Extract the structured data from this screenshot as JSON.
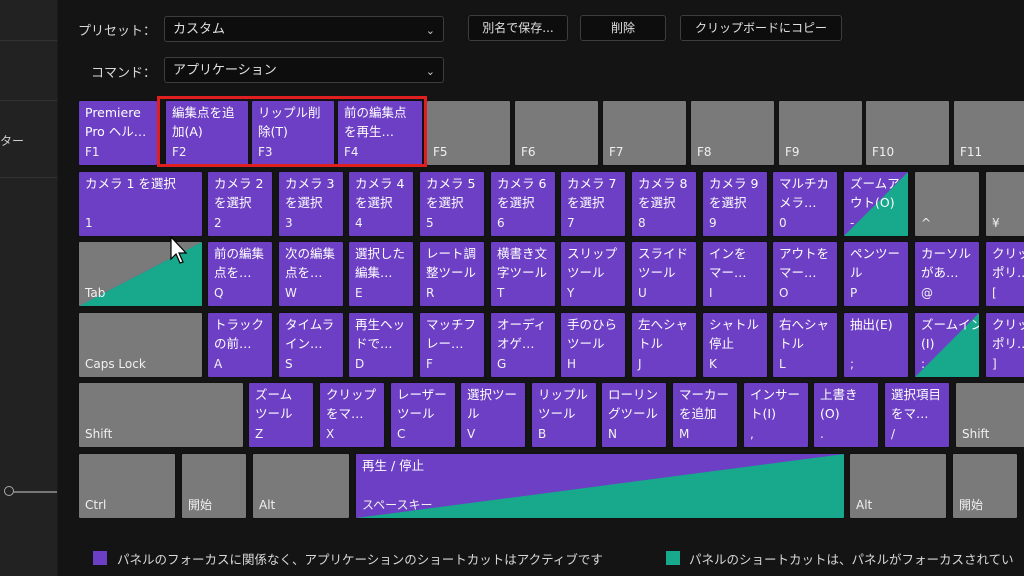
{
  "sidebar": {
    "label": "ター"
  },
  "preset": {
    "label": "プリセット：",
    "value": "カスタム"
  },
  "buttons": {
    "save_as": "別名で保存...",
    "delete": "削除",
    "copy": "クリップボードにコピー"
  },
  "command": {
    "label": "コマンド：",
    "value": "アプリケーション"
  },
  "colors": {
    "purple": "#6c3fc4",
    "green": "#18a88c",
    "gray": "#7a7a7a",
    "highlight": "#e02020"
  },
  "keys": [
    {
      "id": "f1",
      "label": "Premiere\nPro ヘル…",
      "name": "F1",
      "color": "purple"
    },
    {
      "id": "f2",
      "label": "編集点を追\n加(A)",
      "name": "F2",
      "color": "purple"
    },
    {
      "id": "f3",
      "label": "リップル削\n除(T)",
      "name": "F3",
      "color": "purple"
    },
    {
      "id": "f4",
      "label": "前の編集点\nを再生…",
      "name": "F4",
      "color": "purple"
    },
    {
      "id": "f5",
      "label": "",
      "name": "F5",
      "color": "gray"
    },
    {
      "id": "f6",
      "label": "",
      "name": "F6",
      "color": "gray"
    },
    {
      "id": "f7",
      "label": "",
      "name": "F7",
      "color": "gray"
    },
    {
      "id": "f8",
      "label": "",
      "name": "F8",
      "color": "gray"
    },
    {
      "id": "f9",
      "label": "",
      "name": "F9",
      "color": "gray"
    },
    {
      "id": "f10",
      "label": "",
      "name": "F10",
      "color": "gray"
    },
    {
      "id": "f11",
      "label": "",
      "name": "F11",
      "color": "gray"
    },
    {
      "id": "k1",
      "label": "カメラ 1 を選択",
      "name": "1",
      "color": "purple"
    },
    {
      "id": "k2",
      "label": "カメラ 2\nを選択",
      "name": "2",
      "color": "purple"
    },
    {
      "id": "k3",
      "label": "カメラ 3\nを選択",
      "name": "3",
      "color": "purple"
    },
    {
      "id": "k4",
      "label": "カメラ 4\nを選択",
      "name": "4",
      "color": "purple"
    },
    {
      "id": "k5",
      "label": "カメラ 5\nを選択",
      "name": "5",
      "color": "purple"
    },
    {
      "id": "k6",
      "label": "カメラ 6\nを選択",
      "name": "6",
      "color": "purple"
    },
    {
      "id": "k7",
      "label": "カメラ 7\nを選択",
      "name": "7",
      "color": "purple"
    },
    {
      "id": "k8",
      "label": "カメラ 8\nを選択",
      "name": "8",
      "color": "purple"
    },
    {
      "id": "k9",
      "label": "カメラ 9\nを選択",
      "name": "9",
      "color": "purple"
    },
    {
      "id": "k0",
      "label": "マルチカ\nメラ…",
      "name": "0",
      "color": "purple"
    },
    {
      "id": "kminus",
      "label": "ズームア\nウト(O)",
      "name": "-",
      "color": "split"
    },
    {
      "id": "kcaret",
      "label": "",
      "name": "^",
      "color": "gray"
    },
    {
      "id": "kyen",
      "label": "",
      "name": "¥",
      "color": "gray"
    },
    {
      "id": "tab",
      "label": "",
      "name": "Tab",
      "color": "split"
    },
    {
      "id": "kq",
      "label": "前の編集\n点を…",
      "name": "Q",
      "color": "purple"
    },
    {
      "id": "kw",
      "label": "次の編集\n点を…",
      "name": "W",
      "color": "purple"
    },
    {
      "id": "ke",
      "label": "選択した\n編集…",
      "name": "E",
      "color": "purple"
    },
    {
      "id": "kr",
      "label": "レート調\n整ツール",
      "name": "R",
      "color": "purple"
    },
    {
      "id": "kt",
      "label": "横書き文\n字ツール",
      "name": "T",
      "color": "purple"
    },
    {
      "id": "ky",
      "label": "スリップ\nツール",
      "name": "Y",
      "color": "purple"
    },
    {
      "id": "ku",
      "label": "スライド\nツール",
      "name": "U",
      "color": "purple"
    },
    {
      "id": "ki",
      "label": "インを\nマー…",
      "name": "I",
      "color": "purple"
    },
    {
      "id": "ko",
      "label": "アウトを\nマー…",
      "name": "O",
      "color": "purple"
    },
    {
      "id": "kp",
      "label": "ペンツー\nル",
      "name": "P",
      "color": "purple"
    },
    {
      "id": "kat",
      "label": "カーソル\nがあ…",
      "name": "@",
      "color": "purple"
    },
    {
      "id": "kbrl",
      "label": "クリッ\nポリ…",
      "name": "[",
      "color": "purple"
    },
    {
      "id": "caps",
      "label": "",
      "name": "Caps Lock",
      "color": "gray"
    },
    {
      "id": "ka",
      "label": "トラック\nの前…",
      "name": "A",
      "color": "purple"
    },
    {
      "id": "ks",
      "label": "タイムラ\nイン…",
      "name": "S",
      "color": "purple"
    },
    {
      "id": "kd",
      "label": "再生ヘッ\nドで…",
      "name": "D",
      "color": "purple"
    },
    {
      "id": "kf",
      "label": "マッチフ\nレー…",
      "name": "F",
      "color": "purple"
    },
    {
      "id": "kg",
      "label": "オーディ\nオゲ…",
      "name": "G",
      "color": "purple"
    },
    {
      "id": "kh",
      "label": "手のひら\nツール",
      "name": "H",
      "color": "purple"
    },
    {
      "id": "kj",
      "label": "左へシャ\nトル",
      "name": "J",
      "color": "purple"
    },
    {
      "id": "kk",
      "label": "シャトル\n停止",
      "name": "K",
      "color": "purple"
    },
    {
      "id": "kl",
      "label": "右へシャ\nトル",
      "name": "L",
      "color": "purple"
    },
    {
      "id": "ksemi",
      "label": "抽出(E)",
      "name": ";",
      "color": "purple"
    },
    {
      "id": "kcolon",
      "label": "ズームイン\n(I)",
      "name": ":",
      "color": "split"
    },
    {
      "id": "kbrr",
      "label": "クリッ\nポリ…",
      "name": "]",
      "color": "purple"
    },
    {
      "id": "lshift",
      "label": "",
      "name": "Shift",
      "color": "gray"
    },
    {
      "id": "kz",
      "label": "ズーム\nツール",
      "name": "Z",
      "color": "purple"
    },
    {
      "id": "kx",
      "label": "クリップ\nをマ…",
      "name": "X",
      "color": "purple"
    },
    {
      "id": "kc",
      "label": "レーザー\nツール",
      "name": "C",
      "color": "purple"
    },
    {
      "id": "kv",
      "label": "選択ツー\nル",
      "name": "V",
      "color": "purple"
    },
    {
      "id": "kb",
      "label": "リップル\nツール",
      "name": "B",
      "color": "purple"
    },
    {
      "id": "kn",
      "label": "ローリン\nグツール",
      "name": "N",
      "color": "purple"
    },
    {
      "id": "km",
      "label": "マーカー\nを追加",
      "name": "M",
      "color": "purple"
    },
    {
      "id": "kcomma",
      "label": "インサー\nト(I)",
      "name": ",",
      "color": "purple"
    },
    {
      "id": "kperiod",
      "label": "上書き\n(O)",
      "name": ".",
      "color": "purple"
    },
    {
      "id": "kslash",
      "label": "選択項目\nをマ…",
      "name": "/",
      "color": "purple"
    },
    {
      "id": "rshift",
      "label": "",
      "name": "Shift",
      "color": "gray"
    },
    {
      "id": "lctrl",
      "label": "",
      "name": "Ctrl",
      "color": "gray"
    },
    {
      "id": "lstart",
      "label": "",
      "name": "開始",
      "color": "gray"
    },
    {
      "id": "lalt",
      "label": "",
      "name": "Alt",
      "color": "gray"
    },
    {
      "id": "space",
      "label": "再生 / 停止",
      "name": "スペースキー",
      "color": "split"
    },
    {
      "id": "ralt",
      "label": "",
      "name": "Alt",
      "color": "gray"
    },
    {
      "id": "rstart",
      "label": "",
      "name": "開始",
      "color": "gray"
    }
  ],
  "legend": {
    "app": "パネルのフォーカスに関係なく、アプリケーションのショートカットはアクティブです",
    "panel": "パネルのショートカットは、パネルがフォーカスされてい"
  }
}
